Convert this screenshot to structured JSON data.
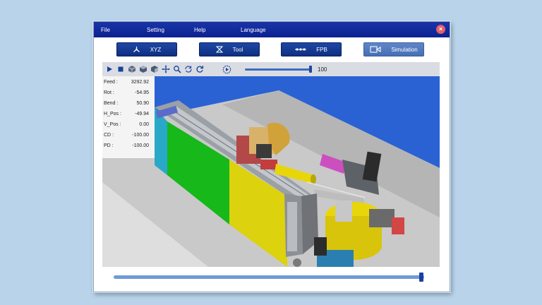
{
  "menu": {
    "file": "File",
    "setting": "Setting",
    "help": "Help",
    "language": "Language",
    "close_glyph": "×"
  },
  "modes": {
    "xyz": "XYZ",
    "tool": "Tool",
    "fpb": "FPB",
    "simulation": "Simulation"
  },
  "toolbar": {
    "speed_value": "100",
    "speed_fraction": 1.0
  },
  "readout": [
    {
      "label": "Feed :",
      "value": "3292.92"
    },
    {
      "label": "Rot :",
      "value": "-54.95"
    },
    {
      "label": "Bend :",
      "value": "50.90"
    },
    {
      "label": "H_Pos :",
      "value": "-49.94"
    },
    {
      "label": "V_Pos :",
      "value": "0.00"
    },
    {
      "label": "CD :",
      "value": "-100.00"
    },
    {
      "label": "PD :",
      "value": "-100.00"
    }
  ],
  "timeline": {
    "position_fraction": 0.99
  },
  "colors": {
    "menubar": "#0b2290",
    "button": "#1e48a6",
    "active_button": "#5f86c8",
    "viewport_bg": "#2a62d4",
    "machine_green": "#16b81a",
    "machine_yellow": "#dcd20e",
    "machine_cyan": "#2aa8c8"
  }
}
